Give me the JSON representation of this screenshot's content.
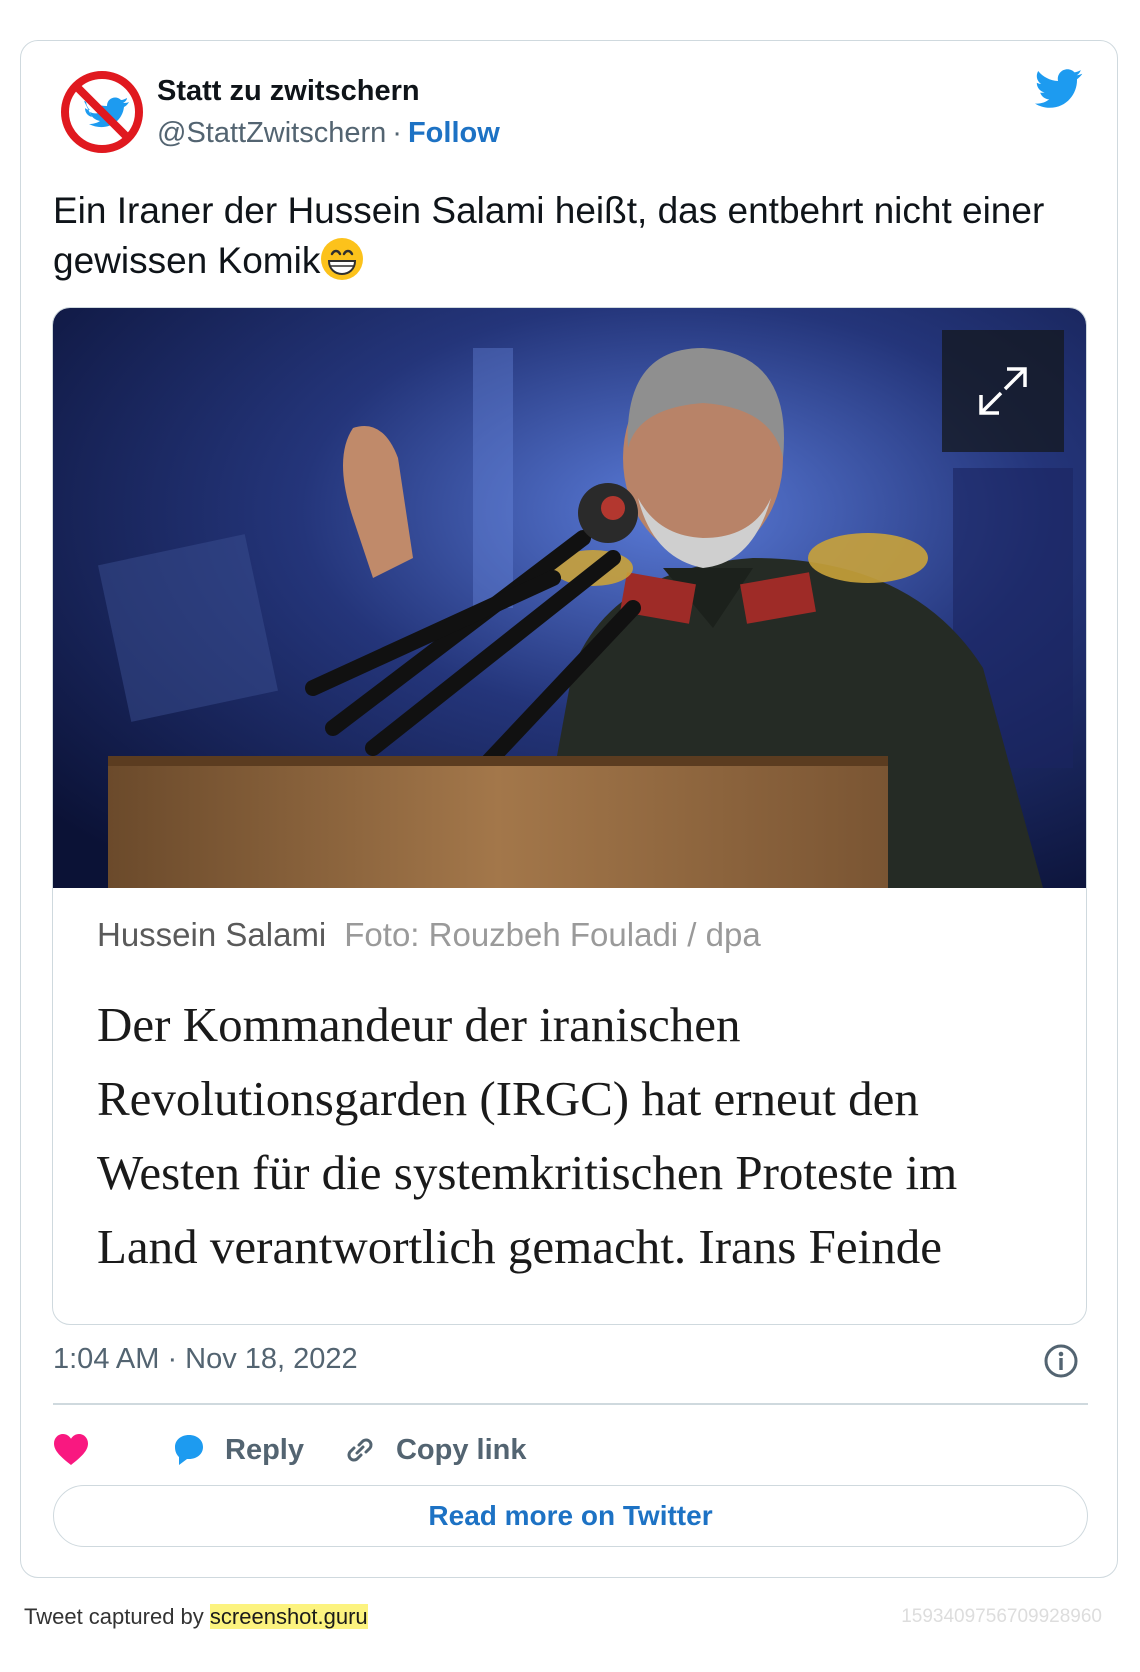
{
  "author": {
    "name": "Statt zu zwitschern",
    "handle": "@StattZwitschern",
    "separator": "·",
    "follow_label": "Follow"
  },
  "tweet": {
    "text": "Ein Iraner der Hussein Salami heißt, das entbehrt nicht einer gewissen Komik",
    "emoji": "grinning-face-emoji"
  },
  "media": {
    "caption_name": "Hussein Salami",
    "caption_credit": "Foto: Rouzbeh Fouladi / dpa",
    "article_text": "Der Kommandeur der iranischen Revolutionsgarden (IRGC) hat erneut den Westen für die systemkritischen Proteste im Land verantwortlich gemacht. Irans Feinde"
  },
  "meta": {
    "timestamp": "1:04 AM · Nov 18, 2022"
  },
  "actions": {
    "like_icon": "heart-icon",
    "reply_label": "Reply",
    "copy_label": "Copy link"
  },
  "read_more_label": "Read more on Twitter",
  "footer": {
    "captured_prefix": "Tweet captured by",
    "captured_site": "screenshot.guru",
    "tweet_id": "1593409756709928960"
  },
  "colors": {
    "link_blue": "#1d72c4",
    "twitter_blue": "#1d9bf0",
    "like_pink": "#f91880",
    "border": "#cfd9de",
    "muted": "#536471"
  }
}
